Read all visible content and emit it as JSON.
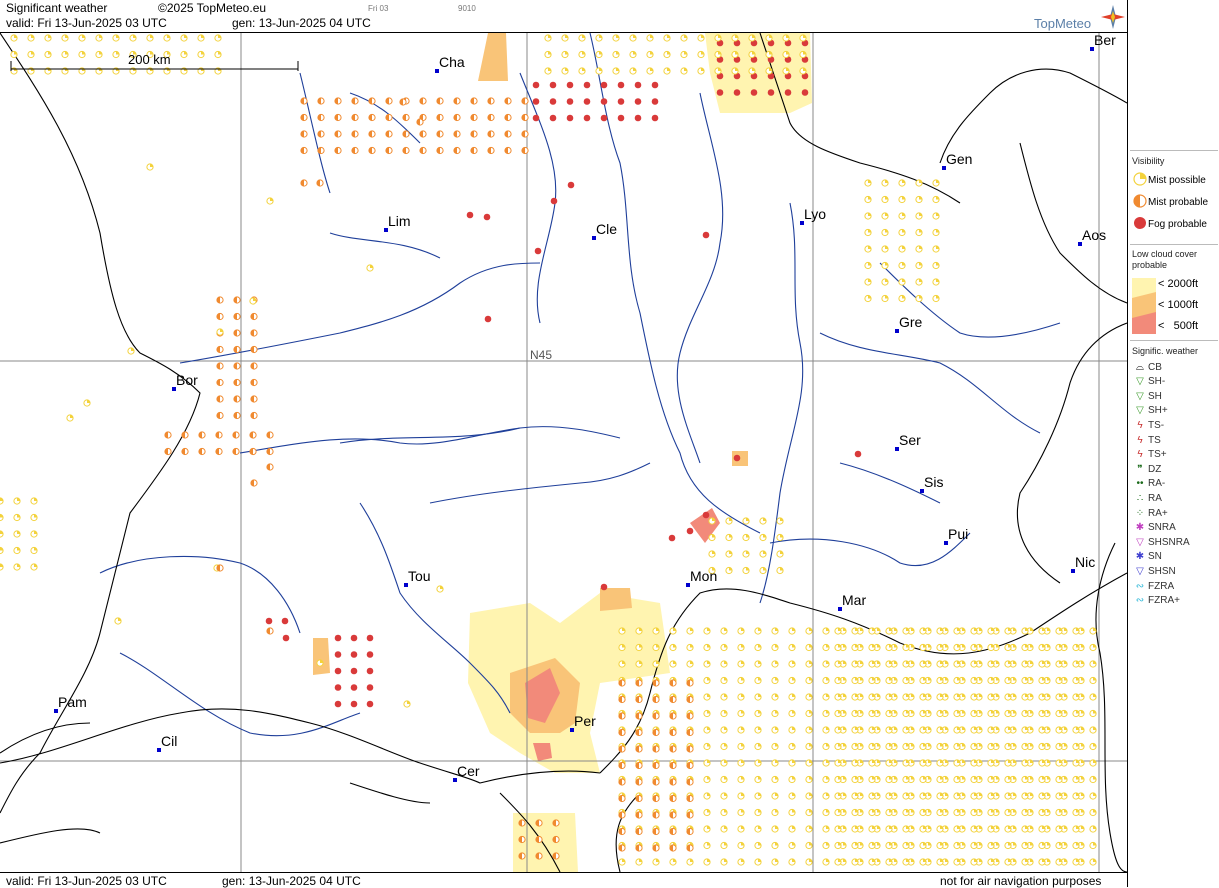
{
  "header": {
    "product": "Significant weather",
    "copyright": "©2025 TopMeteo.eu",
    "code_a": "Fri 03",
    "code_b": "9010",
    "valid": "valid:  Fri  13-Jun-2025  03 UTC",
    "generated": "gen: 13-Jun-2025 04 UTC",
    "brand": "TopMeteo"
  },
  "footer": {
    "valid": "valid:  Fri  13-Jun-2025  03 UTC",
    "generated": "gen: 13-Jun-2025 04 UTC",
    "disclaimer": "not for air navigation purposes"
  },
  "map": {
    "scale_label": "200 km",
    "graticule_label": "N45",
    "colors": {
      "mist_possible": "#f3d23c",
      "mist_probable": "#f08a30",
      "fog_probable": "#d93a3a",
      "cloud_2000": "#fff4b0",
      "cloud_1000": "#f9c478",
      "cloud_500": "#f28a7a",
      "coast": "#000000",
      "river": "#1f3f9a",
      "city": "#0000cc"
    },
    "cities": [
      {
        "name": "Ber"
      },
      {
        "name": "Cha"
      },
      {
        "name": "Gen"
      },
      {
        "name": "Lim"
      },
      {
        "name": "Cle"
      },
      {
        "name": "Lyo"
      },
      {
        "name": "Aos"
      },
      {
        "name": "Gre"
      },
      {
        "name": "Bor"
      },
      {
        "name": "Ser"
      },
      {
        "name": "Sis"
      },
      {
        "name": "Pui"
      },
      {
        "name": "Tou"
      },
      {
        "name": "Mon"
      },
      {
        "name": "Nic"
      },
      {
        "name": "Mar"
      },
      {
        "name": "Pam"
      },
      {
        "name": "Per"
      },
      {
        "name": "Cil"
      },
      {
        "name": "Cer"
      }
    ]
  },
  "legend": {
    "visibility_title": "Visibility",
    "visibility": [
      {
        "label": "Mist possible"
      },
      {
        "label": "Mist probable"
      },
      {
        "label": "Fog probable"
      }
    ],
    "lowcloud_title": "Low cloud cover probable",
    "lowcloud": [
      {
        "label": "< 2000ft"
      },
      {
        "label": "< 1000ft"
      },
      {
        "label": "<   500ft"
      }
    ],
    "sigwx_title": "Signific. weather",
    "sigwx": [
      {
        "label": "CB",
        "icon": "cb-icon",
        "glyph": "⌓",
        "color": "#000000"
      },
      {
        "label": "SH-",
        "icon": "shower-light-icon",
        "glyph": "▽",
        "color": "#3a9a2a"
      },
      {
        "label": "SH",
        "icon": "shower-icon",
        "glyph": "▽",
        "color": "#3a9a2a"
      },
      {
        "label": "SH+",
        "icon": "shower-heavy-icon",
        "glyph": "▽",
        "color": "#3a9a2a"
      },
      {
        "label": "TS-",
        "icon": "thunderstorm-light-icon",
        "glyph": "ϟ",
        "color": "#c83030"
      },
      {
        "label": "TS",
        "icon": "thunderstorm-icon",
        "glyph": "ϟ",
        "color": "#c83030"
      },
      {
        "label": "TS+",
        "icon": "thunderstorm-heavy-icon",
        "glyph": "ϟ",
        "color": "#c83030"
      },
      {
        "label": "DZ",
        "icon": "drizzle-icon",
        "glyph": "❞",
        "color": "#1a6a1a"
      },
      {
        "label": "RA-",
        "icon": "rain-light-icon",
        "glyph": "••",
        "color": "#1a6a1a"
      },
      {
        "label": "RA",
        "icon": "rain-icon",
        "glyph": "∴",
        "color": "#1a6a1a"
      },
      {
        "label": "RA+",
        "icon": "rain-heavy-icon",
        "glyph": "⁘",
        "color": "#1a6a1a"
      },
      {
        "label": "SNRA",
        "icon": "snow-rain-icon",
        "glyph": "✱",
        "color": "#c040c0"
      },
      {
        "label": "SHSNRA",
        "icon": "shower-snow-rain-icon",
        "glyph": "▽",
        "color": "#c040c0"
      },
      {
        "label": "SN",
        "icon": "snow-icon",
        "glyph": "✱",
        "color": "#4040d0"
      },
      {
        "label": "SHSN",
        "icon": "shower-snow-icon",
        "glyph": "▽",
        "color": "#4040d0"
      },
      {
        "label": "FZRA",
        "icon": "freezing-rain-icon",
        "glyph": "∾",
        "color": "#30b8d8"
      },
      {
        "label": "FZRA+",
        "icon": "freezing-rain-heavy-icon",
        "glyph": "∾",
        "color": "#30b8d8"
      }
    ]
  }
}
